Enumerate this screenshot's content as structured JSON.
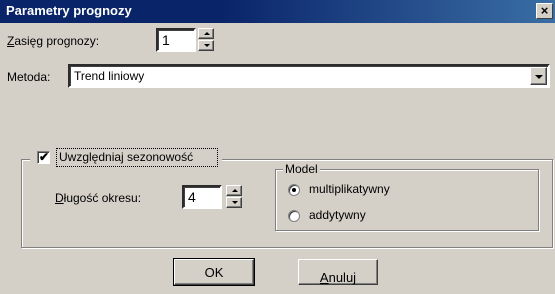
{
  "window": {
    "title": "Parametry prognozy",
    "close_glyph": "×"
  },
  "range": {
    "label_first": "Z",
    "label_rest": "asięg prognozy:",
    "value": "1"
  },
  "method": {
    "label": "Metoda:",
    "value": "Trend liniowy"
  },
  "seasonality": {
    "label": "Uwzględniaj sezonowość",
    "checked": true
  },
  "period": {
    "label_first": "D",
    "label_rest": "ługość okresu:",
    "value": "4"
  },
  "model": {
    "title": "Model",
    "options": [
      {
        "label": "multiplikatywny",
        "selected": true
      },
      {
        "label": "addytywny",
        "selected": false
      }
    ]
  },
  "buttons": {
    "ok": "OK",
    "cancel_first": "A",
    "cancel_rest": "nuluj"
  },
  "icons": {
    "spin_up": "spin-up-icon",
    "spin_down": "spin-down-icon",
    "dropdown": "chevron-down-icon",
    "check": "checkmark-icon"
  },
  "colors": {
    "titlebar": "#0a246a",
    "face": "#d4d0c8"
  }
}
